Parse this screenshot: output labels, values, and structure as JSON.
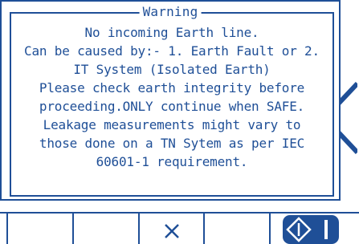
{
  "dialog": {
    "title": "Warning",
    "lines": [
      "No incoming Earth line.",
      "Can be caused by:- 1. Earth Fault or 2.",
      "IT System (Isolated Earth)",
      "Please check earth integrity before",
      "proceeding.ONLY continue when SAFE.",
      "Leakage measurements might vary to",
      "those done on a TN Sytem as per IEC",
      "60601-1 requirement."
    ]
  },
  "softkeys": {
    "cancel_icon": "close-icon",
    "continue_icon": "start-continue-icon"
  },
  "colors": {
    "primary": "#1f4f97",
    "background": "#ffffff"
  }
}
